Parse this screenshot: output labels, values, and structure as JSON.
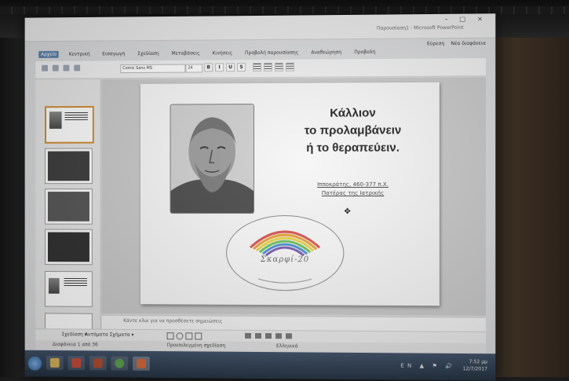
{
  "window": {
    "title": "Παρουσίαση1 - Microsoft PowerPoint",
    "controls": "– □ ×"
  },
  "ribbon_tabs": [
    {
      "label": "Αρχείο"
    },
    {
      "label": "Κεντρική"
    },
    {
      "label": "Εισαγωγή"
    },
    {
      "label": "Σχεδίαση"
    },
    {
      "label": "Μεταβάσεις"
    },
    {
      "label": "Κινήσεις"
    },
    {
      "label": "Προβολή παρουσίασης"
    },
    {
      "label": "Αναθεώρηση"
    },
    {
      "label": "Προβολή"
    }
  ],
  "ribbon_right": {
    "find": "Εύρεση",
    "replace": "Νέα διαφάνεια"
  },
  "ribbon": {
    "font": "Comic Sans MS",
    "size": "24",
    "bold": "B",
    "italic": "I",
    "underline": "U",
    "strike": "S"
  },
  "slide": {
    "quote_line1": "Κάλλιον",
    "quote_line2": "το προλαμβάνειν",
    "quote_line3": "ή το θεραπεύειν.",
    "attribution_line1": "Ιπποκράτης, 460-377 π.Χ.",
    "attribution_line2": "Πατέρας της Ιατρικής",
    "logo_text": "Σκαρφί-20"
  },
  "notes": {
    "placeholder": "Κάντε κλικ για να προσθέσετε σημειώσεις"
  },
  "drawbar": {
    "draw": "Σχεδίαση ▾",
    "autoshapes": "Αυτόματα Σχήματα ▾"
  },
  "status": {
    "slide_count": "Διαφάνεια 1 από 36",
    "theme": "Προεπιλεγμένη σχεδίαση",
    "language": "Ελληνικά"
  },
  "taskbar": {
    "time": "7:52 μμ",
    "date": "12/7/2017",
    "tray": "EN ▲ ⚑ 🔊"
  },
  "colors": {
    "selection": "#d08a2a",
    "taskbar": "#2b3a4e",
    "file_tab": "#5a7fa8"
  }
}
